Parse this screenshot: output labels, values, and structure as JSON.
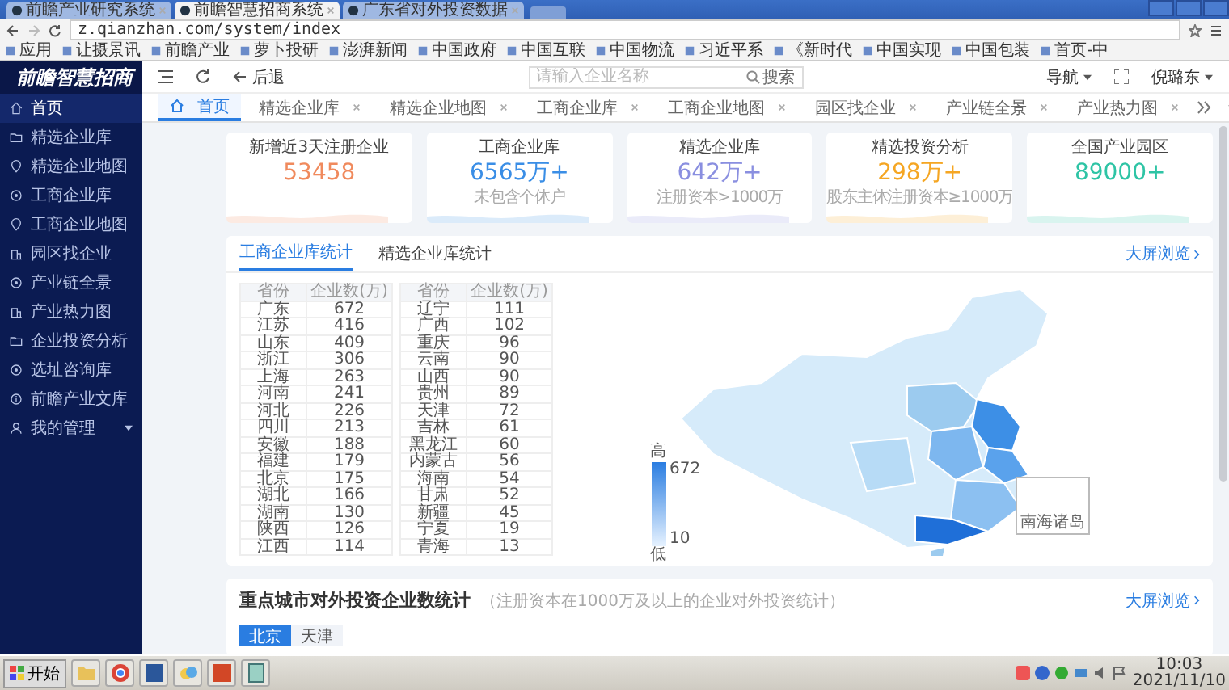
{
  "browser": {
    "tabs": [
      {
        "title": "前瞻产业研究系统",
        "selected": false
      },
      {
        "title": "前瞻智慧招商系统",
        "selected": true
      },
      {
        "title": "广东省对外投资数据",
        "selected": false
      }
    ],
    "url": "z.qianzhan.com/system/index",
    "bookmarks": [
      "应用",
      "让摄景讯",
      "前瞻产业",
      "萝卜投研",
      "澎湃新闻",
      "中国政府",
      "中国互联",
      "中国物流",
      "习近平系",
      "《新时代",
      "中国实现",
      "中国包装",
      "首页-中"
    ]
  },
  "logo": "前瞻智慧招商",
  "sidebar": [
    {
      "label": "首页",
      "selected": true,
      "has_submenu": false
    },
    {
      "label": "精选企业库",
      "selected": false,
      "has_submenu": false
    },
    {
      "label": "精选企业地图",
      "selected": false,
      "has_submenu": false
    },
    {
      "label": "工商企业库",
      "selected": false,
      "has_submenu": false
    },
    {
      "label": "工商企业地图",
      "selected": false,
      "has_submenu": false
    },
    {
      "label": "园区找企业",
      "selected": false,
      "has_submenu": false
    },
    {
      "label": "产业链全景",
      "selected": false,
      "has_submenu": false
    },
    {
      "label": "产业热力图",
      "selected": false,
      "has_submenu": false
    },
    {
      "label": "企业投资分析",
      "selected": false,
      "has_submenu": false
    },
    {
      "label": "选址咨询库",
      "selected": false,
      "has_submenu": false
    },
    {
      "label": "前瞻产业文库",
      "selected": false,
      "has_submenu": false
    },
    {
      "label": "我的管理",
      "selected": false,
      "has_submenu": true
    }
  ],
  "header": {
    "back": "后退",
    "search": {
      "placeholder": "请输入企业名称",
      "button": "搜索"
    },
    "nav_menu": "导航",
    "user": "倪璐东"
  },
  "nav_tabs": [
    {
      "label": "首页",
      "selected": true
    },
    {
      "label": "精选企业库",
      "selected": false
    },
    {
      "label": "精选企业地图",
      "selected": false
    },
    {
      "label": "工商企业库",
      "selected": false
    },
    {
      "label": "工商企业地图",
      "selected": false
    },
    {
      "label": "园区找企业",
      "selected": false
    },
    {
      "label": "产业链全景",
      "selected": false
    },
    {
      "label": "产业热力图",
      "selected": false
    }
  ],
  "stat_cards": [
    {
      "title": "新增近3天注册企业",
      "value": "53458",
      "color": "#f08a5d"
    },
    {
      "title": "工商企业库",
      "value": "6565万+",
      "note": "未包含个体户",
      "color": "#3a8ee6"
    },
    {
      "title": "精选企业库",
      "value": "642万+",
      "note": "注册资本>1000万",
      "color": "#8a8fe0"
    },
    {
      "title": "精选投资分析",
      "value": "298万+",
      "note": "股东主体注册资本≥1000万",
      "color": "#f5a623"
    },
    {
      "title": "全国产业园区",
      "value": "89000+",
      "color": "#2ec4a5"
    }
  ],
  "stats_panel": {
    "tabs": [
      {
        "label": "工商企业库统计",
        "selected": true
      },
      {
        "label": "精选企业库统计",
        "selected": false
      }
    ],
    "link": "大屏浏览",
    "tables": [
      {
        "columns": [
          "省份",
          "企业数(万)"
        ],
        "rows": [
          [
            "广东",
            "672"
          ],
          [
            "江苏",
            "416"
          ],
          [
            "山东",
            "409"
          ],
          [
            "浙江",
            "306"
          ],
          [
            "上海",
            "263"
          ],
          [
            "河南",
            "241"
          ],
          [
            "河北",
            "226"
          ],
          [
            "四川",
            "213"
          ],
          [
            "安徽",
            "188"
          ],
          [
            "福建",
            "179"
          ],
          [
            "北京",
            "175"
          ],
          [
            "湖北",
            "166"
          ],
          [
            "湖南",
            "130"
          ],
          [
            "陕西",
            "126"
          ],
          [
            "江西",
            "114"
          ]
        ]
      },
      {
        "columns": [
          "省份",
          "企业数(万)"
        ],
        "rows": [
          [
            "辽宁",
            "111"
          ],
          [
            "广西",
            "102"
          ],
          [
            "重庆",
            "96"
          ],
          [
            "云南",
            "90"
          ],
          [
            "山西",
            "90"
          ],
          [
            "贵州",
            "89"
          ],
          [
            "天津",
            "72"
          ],
          [
            "吉林",
            "61"
          ],
          [
            "黑龙江",
            "60"
          ],
          [
            "内蒙古",
            "56"
          ],
          [
            "海南",
            "54"
          ],
          [
            "甘肃",
            "52"
          ],
          [
            "新疆",
            "45"
          ],
          [
            "宁夏",
            "19"
          ],
          [
            "青海",
            "13"
          ]
        ]
      }
    ],
    "map": {
      "legend": {
        "high": "高",
        "max": "672",
        "min": "10",
        "low": "低"
      },
      "inset": "南海诸岛"
    }
  },
  "city_panel": {
    "title": "重点城市对外投资企业数统计",
    "note": "（注册资本在1000万及以上的企业对外投资统计）",
    "link": "大屏浏览",
    "city_tabs": [
      {
        "label": "北京",
        "selected": true
      },
      {
        "label": "天津",
        "selected": false
      }
    ]
  },
  "taskbar": {
    "start": "开始",
    "time": "10:03",
    "date": "2021/11/10"
  }
}
